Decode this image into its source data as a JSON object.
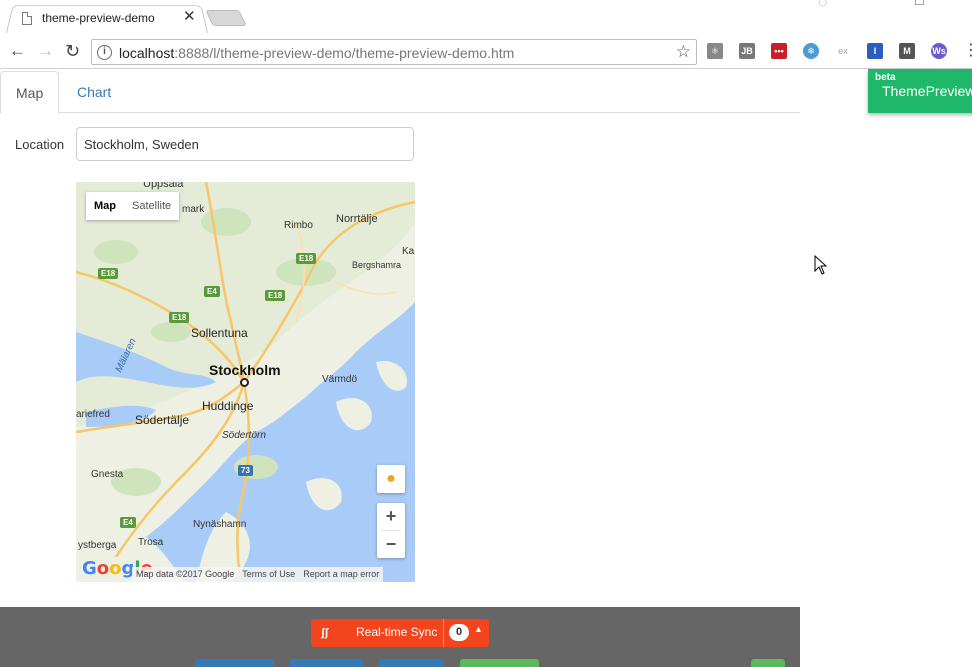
{
  "browser": {
    "tab_title": "theme-preview-demo",
    "tab_close": "✕",
    "url_host": "localhost",
    "url_rest": ":8888/l/theme-preview-demo/theme-preview-demo.htm",
    "extensions": [
      "⚛",
      "JB",
      "•••",
      "❄",
      "ex",
      "I",
      "M",
      "Ws"
    ]
  },
  "page_tabs": [
    {
      "label": "Map",
      "active": true
    },
    {
      "label": "Chart",
      "active": false
    }
  ],
  "location": {
    "label": "Location",
    "value": "Stockholm, Sweden"
  },
  "map": {
    "type_options": [
      "Map",
      "Satellite"
    ],
    "selected_type": "Map",
    "places": {
      "uppsala": "Uppsala",
      "marsta": "mark",
      "norrtalje": "Norrtälje",
      "rimbo": "Rimbo",
      "kapell": "Ka",
      "bergshamra": "Bergshamra",
      "sollentuna": "Sollentuna",
      "stockholm": "Stockholm",
      "varmdo": "Värmdö",
      "huddinge": "Huddinge",
      "sodertalje": "Södertälje",
      "mariefred": "ariefred",
      "sodertorn": "Södertörn",
      "malaren": "Mälaren",
      "gnesta": "Gnesta",
      "nynashamn": "Nynäshamn",
      "trosa": "Trosa",
      "nystbergа": "ystberga"
    },
    "road_shields": [
      "E18",
      "E4",
      "E18",
      "E18",
      "E18",
      "E4",
      "73",
      "E4"
    ],
    "zoom_in": "+",
    "zoom_out": "−",
    "google_logo": "Google",
    "attribution": [
      "Map data ©2017 Google",
      "Terms of Use",
      "Report a map error"
    ]
  },
  "theme_preview": {
    "badge": "beta",
    "name": "ThemePreview"
  },
  "sync": {
    "logo": "ʃʃ",
    "label": "Real-time Sync",
    "count": "0",
    "caret": "▲"
  },
  "colors": {
    "brand_green": "#1fb86a",
    "sync_red": "#f2441d",
    "link_blue": "#337ab7",
    "bottom_bar": "#666666"
  }
}
